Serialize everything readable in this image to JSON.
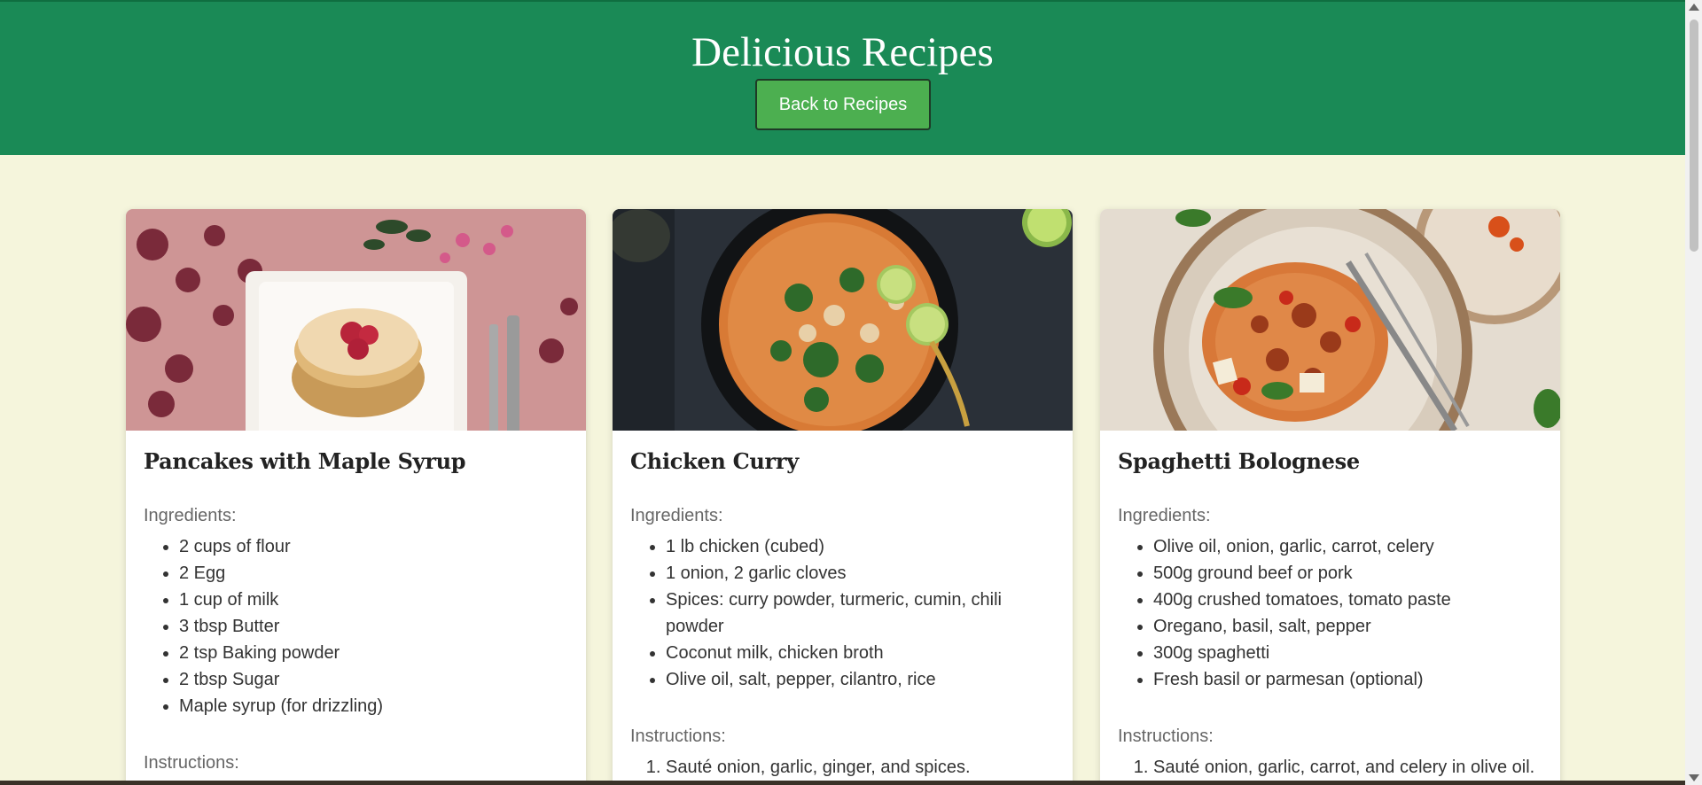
{
  "header": {
    "title": "Delicious Recipes",
    "back_button": "Back to Recipes"
  },
  "recipes": [
    {
      "title": "Pancakes with Maple Syrup",
      "image": "pancakes-photo",
      "ingredients_label": "Ingredients:",
      "ingredients": [
        "2 cups of flour",
        "2 Egg",
        "1 cup of milk",
        "3 tbsp Butter",
        "2 tsp Baking powder",
        "2 tbsp Sugar",
        "Maple syrup (for drizzling)"
      ],
      "instructions_label": "Instructions:",
      "instructions": []
    },
    {
      "title": "Chicken Curry",
      "image": "curry-photo",
      "ingredients_label": "Ingredients:",
      "ingredients": [
        "1 lb chicken (cubed)",
        "1 onion, 2 garlic cloves",
        "Spices: curry powder, turmeric, cumin, chili powder",
        "Coconut milk, chicken broth",
        "Olive oil, salt, pepper, cilantro, rice"
      ],
      "instructions_label": "Instructions:",
      "instructions": [
        "Sauté onion, garlic, ginger, and spices."
      ]
    },
    {
      "title": "Spaghetti Bolognese",
      "image": "spaghetti-photo",
      "ingredients_label": "Ingredients:",
      "ingredients": [
        "Olive oil, onion, garlic, carrot, celery",
        "500g ground beef or pork",
        "400g crushed tomatoes, tomato paste",
        "Oregano, basil, salt, pepper",
        "300g spaghetti",
        "Fresh basil or parmesan (optional)"
      ],
      "instructions_label": "Instructions:",
      "instructions": [
        "Sauté onion, garlic, carrot, and celery in olive oil."
      ]
    }
  ],
  "colors": {
    "header_bg": "#1a8a56",
    "button_bg": "#4caf50",
    "page_bg": "#f5f5dc"
  }
}
